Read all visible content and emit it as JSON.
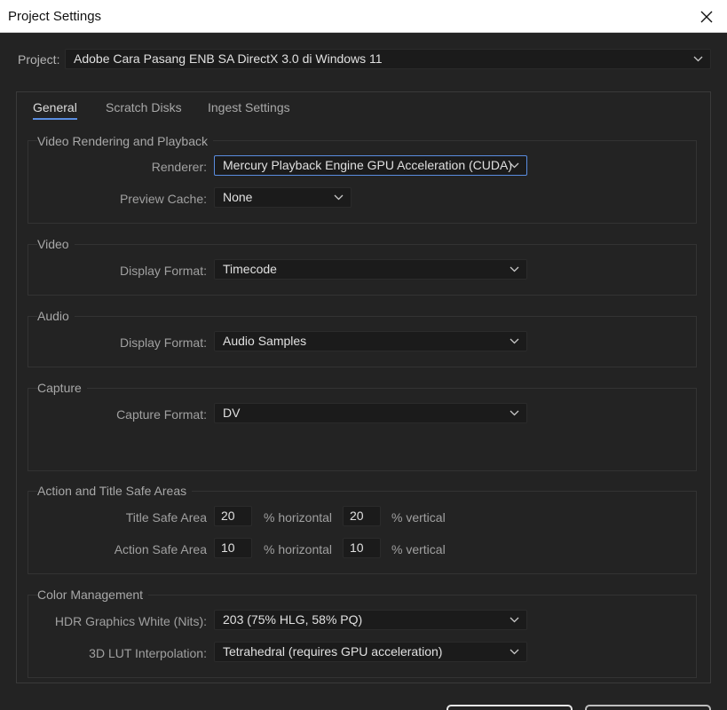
{
  "window": {
    "title": "Project Settings"
  },
  "project": {
    "label": "Project:",
    "value": "Adobe Cara Pasang ENB SA DirectX 3.0 di Windows 11"
  },
  "tabs": [
    {
      "label": "General"
    },
    {
      "label": "Scratch Disks"
    },
    {
      "label": "Ingest Settings"
    }
  ],
  "video_rendering": {
    "title": "Video Rendering and Playback",
    "renderer_label": "Renderer:",
    "renderer_value": "Mercury Playback Engine GPU Acceleration (CUDA)",
    "preview_cache_label": "Preview Cache:",
    "preview_cache_value": "None"
  },
  "video": {
    "title": "Video",
    "display_format_label": "Display Format:",
    "display_format_value": "Timecode"
  },
  "audio": {
    "title": "Audio",
    "display_format_label": "Display Format:",
    "display_format_value": "Audio Samples"
  },
  "capture": {
    "title": "Capture",
    "capture_format_label": "Capture Format:",
    "capture_format_value": "DV"
  },
  "safe_areas": {
    "title": "Action and Title Safe Areas",
    "title_safe_label": "Title Safe Area",
    "title_safe_h": "20",
    "title_safe_v": "20",
    "action_safe_label": "Action Safe Area",
    "action_safe_h": "10",
    "action_safe_v": "10",
    "horizontal_unit": "% horizontal",
    "vertical_unit": "% vertical"
  },
  "color_management": {
    "title": "Color Management",
    "hdr_label": "HDR Graphics White (Nits):",
    "hdr_value": "203 (75% HLG, 58% PQ)",
    "lut_label": "3D LUT Interpolation:",
    "lut_value": "Tetrahedral (requires GPU acceleration)"
  },
  "colors": {
    "accent": "#5a8de0",
    "background": "#232323",
    "field": "#1b1b1b"
  }
}
